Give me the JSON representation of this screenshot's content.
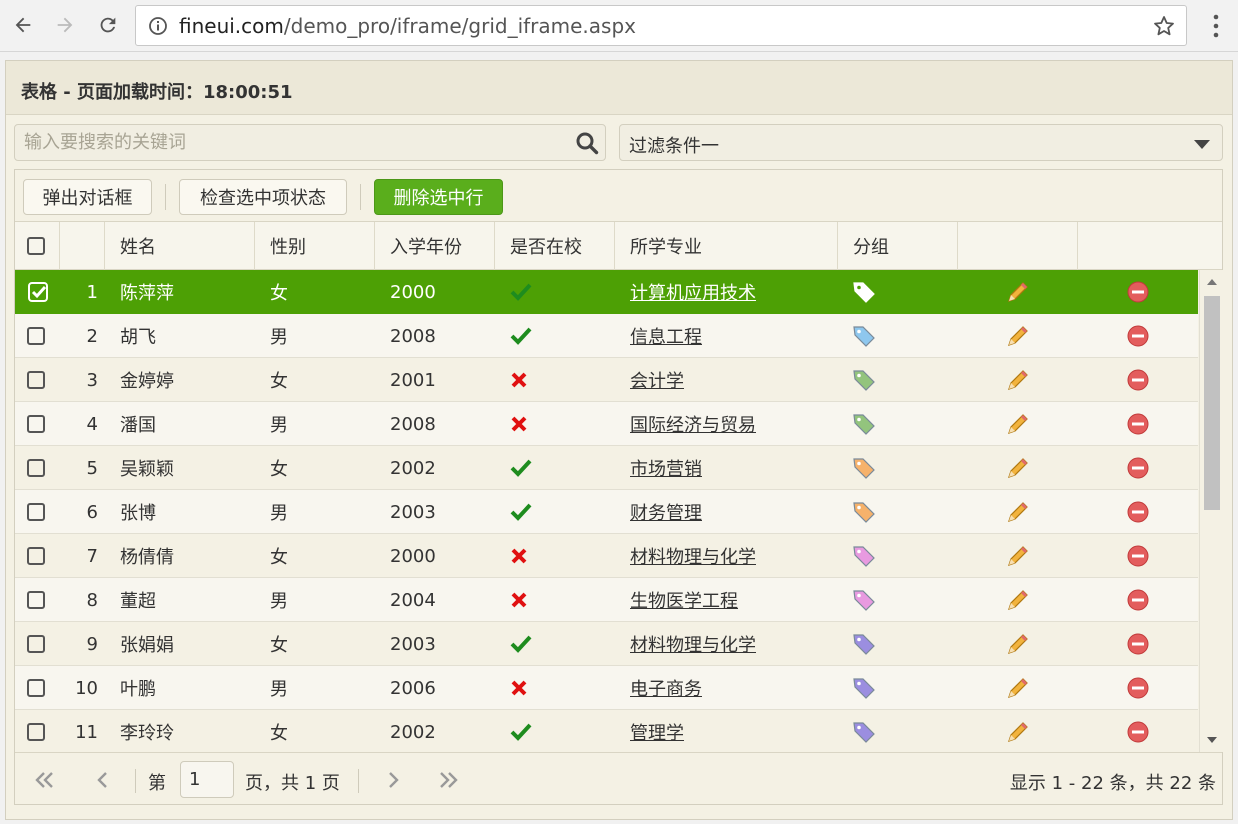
{
  "browser": {
    "url_host": "fineui.com",
    "url_path": "/demo_pro/iframe/grid_iframe.aspx"
  },
  "panel": {
    "title": "表格 - 页面加载时间：18:00:51"
  },
  "search": {
    "placeholder": "输入要搜索的关键词"
  },
  "filter": {
    "selected": "过滤条件一"
  },
  "toolbar": {
    "popup_dialog": "弹出对话框",
    "check_selected": "检查选中项状态",
    "delete_selected": "删除选中行"
  },
  "columns": {
    "name": "姓名",
    "gender": "性别",
    "year": "入学年份",
    "enrolled": "是否在校",
    "major": "所学专业",
    "group": "分组"
  },
  "rows": [
    {
      "num": "1",
      "name": "陈萍萍",
      "gender": "女",
      "year": "2000",
      "enrolled": true,
      "major": "计算机应用技术",
      "tag_color": "#8ec7ee",
      "selected": true
    },
    {
      "num": "2",
      "name": "胡飞",
      "gender": "男",
      "year": "2008",
      "enrolled": true,
      "major": "信息工程",
      "tag_color": "#8ec7ee",
      "selected": false
    },
    {
      "num": "3",
      "name": "金婷婷",
      "gender": "女",
      "year": "2001",
      "enrolled": false,
      "major": "会计学",
      "tag_color": "#93c47d",
      "selected": false
    },
    {
      "num": "4",
      "name": "潘国",
      "gender": "男",
      "year": "2008",
      "enrolled": false,
      "major": "国际经济与贸易",
      "tag_color": "#93c47d",
      "selected": false
    },
    {
      "num": "5",
      "name": "吴颖颖",
      "gender": "女",
      "year": "2002",
      "enrolled": true,
      "major": "市场营销",
      "tag_color": "#f6b26b",
      "selected": false
    },
    {
      "num": "6",
      "name": "张博",
      "gender": "男",
      "year": "2003",
      "enrolled": true,
      "major": "财务管理",
      "tag_color": "#f6b26b",
      "selected": false
    },
    {
      "num": "7",
      "name": "杨倩倩",
      "gender": "女",
      "year": "2000",
      "enrolled": false,
      "major": "材料物理与化学",
      "tag_color": "#e89ae0",
      "selected": false
    },
    {
      "num": "8",
      "name": "董超",
      "gender": "男",
      "year": "2004",
      "enrolled": false,
      "major": "生物医学工程",
      "tag_color": "#e89ae0",
      "selected": false
    },
    {
      "num": "9",
      "name": "张娟娟",
      "gender": "女",
      "year": "2003",
      "enrolled": true,
      "major": "材料物理与化学",
      "tag_color": "#9b8ee0",
      "selected": false
    },
    {
      "num": "10",
      "name": "叶鹏",
      "gender": "男",
      "year": "2006",
      "enrolled": false,
      "major": "电子商务",
      "tag_color": "#9b8ee0",
      "selected": false
    },
    {
      "num": "11",
      "name": "李玲玲",
      "gender": "女",
      "year": "2002",
      "enrolled": true,
      "major": "管理学",
      "tag_color": "#9b8ee0",
      "selected": false
    }
  ],
  "pager": {
    "page_prefix": "第",
    "page_value": "1",
    "page_suffix": "页，共 1 页",
    "info": "显示 1 - 22 条，共 22 条"
  },
  "colors": {
    "selected_row": "#4da005",
    "delete_button": "#5aae1c",
    "check": "#1e8c1e",
    "cross": "#e01010"
  }
}
